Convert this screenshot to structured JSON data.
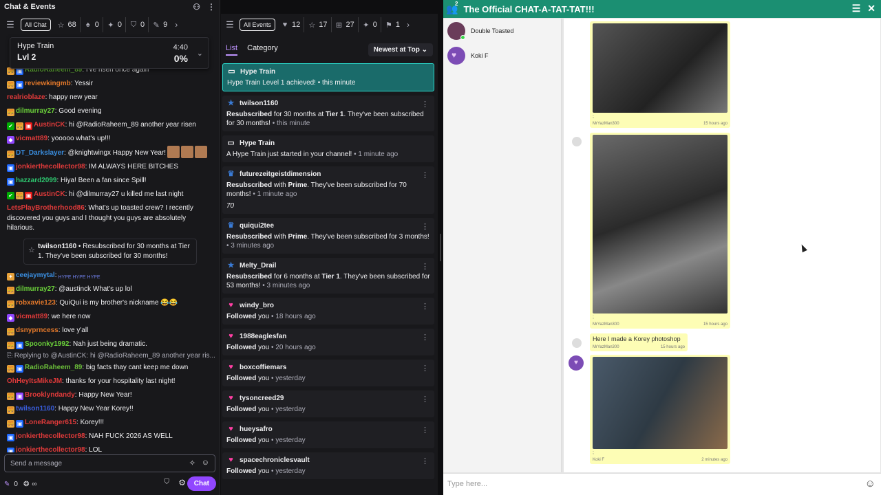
{
  "chat": {
    "title": "Chat & Events",
    "filter_all": "All Chat",
    "filters": [
      {
        "icon": "☆",
        "name": "star-icon",
        "count": "68"
      },
      {
        "icon": "♠",
        "name": "shield-icon",
        "count": "0"
      },
      {
        "icon": "✦",
        "name": "sparkle-icon",
        "count": "0"
      },
      {
        "icon": "⛉",
        "name": "mod-shield-icon",
        "count": "0"
      },
      {
        "icon": "✎",
        "name": "pencil-icon",
        "count": "9"
      }
    ],
    "hype": {
      "label": "Hype Train",
      "level": "Lvl 2",
      "time": "4:40",
      "percent": "0%"
    },
    "messages": [
      {
        "badges": [
          [
            "o",
            "🍔"
          ],
          [
            "b",
            "▣"
          ]
        ],
        "user": "RadioRaheem_89",
        "color": "#6bbf3a",
        "text": ": I've risen once again"
      },
      {
        "badges": [
          [
            "o",
            "🍔"
          ],
          [
            "b",
            "▣"
          ]
        ],
        "user": "reviewkingmb",
        "color": "#e2782a",
        "text": ": Yessir"
      },
      {
        "badges": [],
        "user": "realrioblaze",
        "color": "#e03a3a",
        "text": ": happy new year"
      },
      {
        "badges": [
          [
            "o",
            "🍔"
          ]
        ],
        "user": "dilmurray27",
        "color": "#6bd13a",
        "text": ": Good evening"
      },
      {
        "badges": [
          [
            "g",
            "✔"
          ],
          [
            "o",
            "🍔"
          ],
          [
            "r",
            "▣"
          ]
        ],
        "user": "AustinCK",
        "color": "#e03a3a",
        "text": ": hi @RadioRaheem_89 another year risen"
      },
      {
        "badges": [
          [
            "p",
            "◆"
          ]
        ],
        "user": "vicmatt89",
        "color": "#e03a3a",
        "text": ": yooooo what's up!!!"
      },
      {
        "badges": [
          [
            "o",
            "🍔"
          ]
        ],
        "user": "DT_Darkslayer",
        "color": "#3a8ee0",
        "text": ": @knightwingx Happy New Year!"
      },
      {
        "badges": [
          [
            "b",
            "▣"
          ]
        ],
        "user": "jonkierthecollector98",
        "color": "#e03a3a",
        "text": ": IM ALWAYS HERE BITCHES"
      },
      {
        "badges": [
          [
            "b",
            "▣"
          ]
        ],
        "user": "hazzard2099",
        "color": "#2ec66f",
        "text": ": Hiya! Been a fan since Spill!"
      },
      {
        "badges": [
          [
            "g",
            "✔"
          ],
          [
            "o",
            "🍔"
          ],
          [
            "r",
            "▣"
          ]
        ],
        "user": "AustinCK",
        "color": "#e03a3a",
        "text": ": hi @dilmurray27 u killed me last night"
      }
    ],
    "wrap_message": {
      "user": "LetsPlayBrotherhood86",
      "color": "#e03a3a",
      "text": ": What's up toasted crew? I recently discovered you guys and I thought you guys are absolutely hilarious."
    },
    "sub_note": {
      "user": "twilson1160",
      "text": " • Resubscribed for 30 months at Tier 1. They've been subscribed for 30 months!"
    },
    "messages2": [
      {
        "badges": [
          [
            "o",
            "✦"
          ]
        ],
        "user": "ceejaymytal",
        "color": "#3a8ee0",
        "text": ":",
        "hype": "HYPE HYPE HYPE"
      },
      {
        "badges": [
          [
            "o",
            "🍔"
          ]
        ],
        "user": "dilmurray27",
        "color": "#6bd13a",
        "text": ": @austinck What's up lol"
      },
      {
        "badges": [
          [
            "o",
            "🍔"
          ]
        ],
        "user": "robxavie123",
        "color": "#e2782a",
        "text": ": QuiQui is my brother's nickname 😂😂"
      },
      {
        "badges": [
          [
            "p",
            "◆"
          ]
        ],
        "user": "vicmatt89",
        "color": "#e03a3a",
        "text": ": we here now"
      },
      {
        "badges": [
          [
            "o",
            "🍔"
          ]
        ],
        "user": "dsnyprncess",
        "color": "#e2782a",
        "text": ": love y'all"
      },
      {
        "badges": [
          [
            "o",
            "🍔"
          ],
          [
            "b",
            "▣"
          ]
        ],
        "user": "Spoonky1992",
        "color": "#6bd13a",
        "text": ": Nah just being dramatic."
      }
    ],
    "reply_line": "Replying to @AustinCK: hi @RadioRaheem_89 another year ris...",
    "messages3": [
      {
        "badges": [
          [
            "o",
            "🍔"
          ],
          [
            "b",
            "▣"
          ]
        ],
        "user": "RadioRaheem_89",
        "color": "#6bbf3a",
        "text": ": big facts thay cant keep me down"
      },
      {
        "badges": [],
        "user": "OhHeyItsMikeJM",
        "color": "#e03a3a",
        "text": ": thanks for your hospitality last night!"
      },
      {
        "badges": [
          [
            "o",
            "🍔"
          ],
          [
            "p",
            "▣"
          ]
        ],
        "user": "Brooklyndandy",
        "color": "#e03a3a",
        "text": ": Happy New Year!"
      },
      {
        "badges": [
          [
            "o",
            "🍔"
          ]
        ],
        "user": "twilson1160",
        "color": "#3a5ee0",
        "text": ": Happy New Year Korey!!"
      },
      {
        "badges": [
          [
            "o",
            "🍔"
          ],
          [
            "b",
            "▣"
          ]
        ],
        "user": "LoneRanger615",
        "color": "#e03a3a",
        "text": ": Korey!!!"
      },
      {
        "badges": [
          [
            "b",
            "▣"
          ]
        ],
        "user": "jonkierthecollector98",
        "color": "#e03a3a",
        "text": ": NAH FUCK 2026 AS WELL"
      },
      {
        "badges": [
          [
            "b",
            "▣"
          ]
        ],
        "user": "jonkierthecollector98",
        "color": "#e03a3a",
        "text": ": LOL"
      }
    ],
    "input_placeholder": "Send a message",
    "points": "0",
    "infinity": "∞",
    "chat_button": "Chat"
  },
  "events": {
    "filter_all": "All Events",
    "filters": [
      {
        "icon": "♥",
        "name": "heart-icon",
        "count": "12"
      },
      {
        "icon": "☆",
        "name": "star-icon",
        "count": "17"
      },
      {
        "icon": "⊞",
        "name": "gift-icon",
        "count": "27"
      },
      {
        "icon": "✦",
        "name": "bits-icon",
        "count": "0"
      },
      {
        "icon": "⚑",
        "name": "raid-icon",
        "count": "1"
      }
    ],
    "tab_list": "List",
    "tab_category": "Category",
    "sort": "Newest at Top",
    "items": [
      {
        "kind": "hype",
        "icon": "▭",
        "title": "Hype Train",
        "body": "Hype Train Level 1 achieved!",
        "ago": "this minute",
        "hl": true
      },
      {
        "kind": "sub",
        "icon": "★",
        "icolor": "#3a7bd5",
        "title": "twilson1160",
        "pre": "Resubscribed",
        "mid": " for 30 months at ",
        "bold2": "Tier 1",
        "post": ". They've been subscribed for 30 months!",
        "ago": "this minute"
      },
      {
        "kind": "hype",
        "icon": "▭",
        "title": "Hype Train",
        "body": "A Hype Train just started in your channel!",
        "ago": "1 minute ago"
      },
      {
        "kind": "sub",
        "icon": "♛",
        "icolor": "#3a7bd5",
        "title": "futurezeitgeistdimension",
        "pre": "Resubscribed",
        "mid": " with ",
        "bold2": "Prime",
        "post": ". They've been subscribed for 70 months!",
        "ago": "1 minute ago",
        "note": "70"
      },
      {
        "kind": "sub",
        "icon": "♛",
        "icolor": "#3a7bd5",
        "title": "quiqui2tee",
        "pre": "Resubscribed",
        "mid": " with ",
        "bold2": "Prime",
        "post": ". They've been subscribed for 3 months!",
        "ago": "3 minutes ago"
      },
      {
        "kind": "sub",
        "icon": "★",
        "icolor": "#3a7bd5",
        "title": "Melty_Drail",
        "pre": "Resubscribed",
        "mid": " for 6 months at ",
        "bold2": "Tier 1",
        "post": ". They've been subscribed for 53 months!",
        "ago": "3 minutes ago"
      },
      {
        "kind": "follow",
        "icon": "♥",
        "icolor": "#ff3fa4",
        "title": "windy_bro",
        "pre": "Followed",
        "post": " you",
        "ago": "18 hours ago"
      },
      {
        "kind": "follow",
        "icon": "♥",
        "icolor": "#ff3fa4",
        "title": "1988eaglesfan",
        "pre": "Followed",
        "post": " you",
        "ago": "20 hours ago"
      },
      {
        "kind": "follow",
        "icon": "♥",
        "icolor": "#ff3fa4",
        "title": "boxcoffiemars",
        "pre": "Followed",
        "post": " you",
        "ago": "yesterday"
      },
      {
        "kind": "follow",
        "icon": "♥",
        "icolor": "#ff3fa4",
        "title": "tysoncreed29",
        "pre": "Followed",
        "post": " you",
        "ago": "yesterday"
      },
      {
        "kind": "follow",
        "icon": "♥",
        "icolor": "#ff3fa4",
        "title": "hueysafro",
        "pre": "Followed",
        "post": " you",
        "ago": "yesterday"
      },
      {
        "kind": "follow",
        "icon": "♥",
        "icolor": "#ff3fa4",
        "title": "spacechroniclesvault",
        "pre": "Followed",
        "post": " you",
        "ago": "yesterday"
      }
    ]
  },
  "app": {
    "title": "The Official CHAT-A-TAT-TAT!!!",
    "badge": "2",
    "roster": [
      {
        "name": "Double Toasted",
        "av": "toasted"
      },
      {
        "name": "Koki F",
        "av": "heart"
      }
    ],
    "posts": [
      {
        "sender": "MrYazMan300",
        "time": "15 hours ago",
        "mark": ";"
      },
      {
        "sender": "MrYazMan300",
        "time": "15 hours ago",
        "mark": ";"
      },
      {
        "sender": "MrYazMan300",
        "time": "15 hours ago",
        "text": "Here I made a Korey photoshop"
      },
      {
        "sender": "Koki F",
        "time": "2 minutes ago",
        "mark": ";"
      }
    ],
    "compose_placeholder": "Type here..."
  }
}
